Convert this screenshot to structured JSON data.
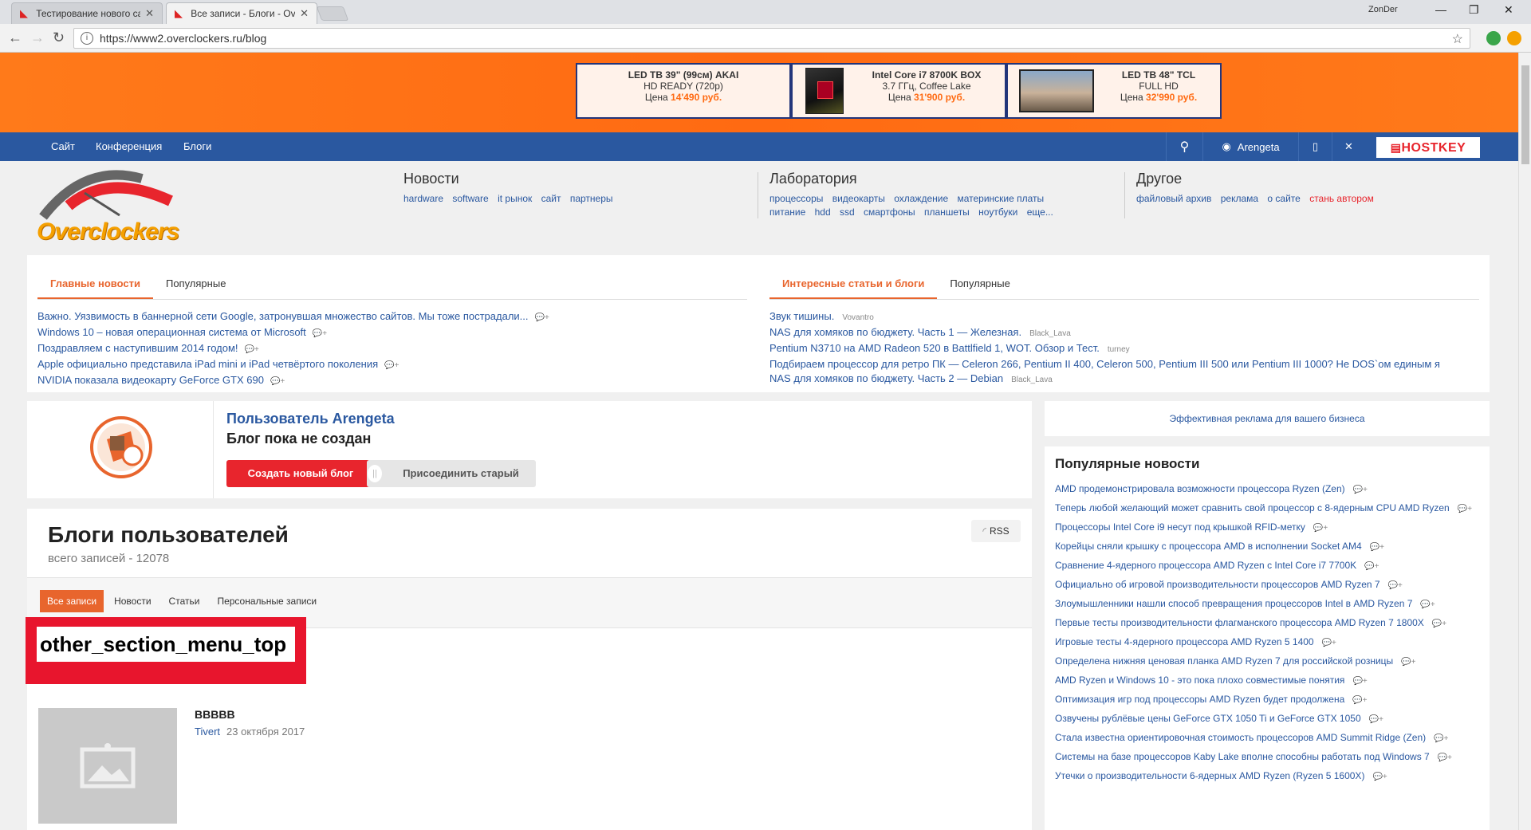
{
  "browser": {
    "tabs": [
      {
        "title": "Тестирование нового са",
        "active": false
      },
      {
        "title": "Все записи - Блоги - Ove",
        "active": true
      }
    ],
    "user_chip": "ZonDer",
    "url": "https://www2.overclockers.ru/blog"
  },
  "banner": {
    "ads": [
      {
        "name": "LED ТВ 39\" (99см) AKAI",
        "line2": "HD READY (720p)",
        "price_prefix": "Цена ",
        "price": "14'490 руб."
      },
      {
        "name": "Intel Core i7 8700K BOX",
        "line2": "3.7 ГГц, Coffee Lake",
        "price_prefix": "Цена ",
        "price": "31'900 руб."
      },
      {
        "name": "LED ТВ 48\" TCL",
        "line2": "FULL HD",
        "price_prefix": "Цена ",
        "price": "32'990 руб."
      }
    ]
  },
  "nav": {
    "links": [
      "Сайт",
      "Конференция",
      "Блоги"
    ],
    "user": "Arengeta",
    "sponsor": "HOSTKEY"
  },
  "logo_text": "Overclockers",
  "header": {
    "news": {
      "title": "Новости",
      "links": [
        "hardware",
        "software",
        "it рынок",
        "сайт",
        "партнеры"
      ]
    },
    "lab": {
      "title": "Лаборатория",
      "links1": [
        "процессоры",
        "видеокарты",
        "охлаждение",
        "материнские платы"
      ],
      "links2": [
        "питание",
        "hdd",
        "ssd",
        "смартфоны",
        "планшеты",
        "ноутбуки",
        "еще..."
      ]
    },
    "other": {
      "title": "Другое",
      "links": [
        "файловый архив",
        "реклама",
        "о сайте"
      ],
      "highlight": "стань автором"
    }
  },
  "news_panel": {
    "tabs": [
      "Главные новости",
      "Популярные"
    ],
    "items": [
      "Важно. Уязвимость в баннерной сети Google, затронувшая множество сайтов. Мы тоже пострадали...",
      "Windows 10 – новая операционная система от Microsoft",
      "Поздравляем с наступившим 2014 годом!",
      "Apple официально представила iPad mini и iPad четвёртого поколения",
      "NVIDIA показала видеокарту GeForce GTX 690"
    ]
  },
  "articles_panel": {
    "tabs": [
      "Интересные статьи и блоги",
      "Популярные"
    ],
    "items": [
      {
        "title": "Звук тишины.",
        "author": "Vovantro"
      },
      {
        "title": "NAS для хомяков по бюджету. Часть 1 — Железная.",
        "author": "Black_Lava"
      },
      {
        "title": "Pentium N3710 на AMD Radeon 520 в Battlfield 1, WOT. Обзор и Тест.",
        "author": "turney"
      },
      {
        "title": "Подбираем процессор для ретро ПК — Celeron 266, Pentium II 400, Celeron 500, Pentium III 500 или Pentium III 1000? Не DOS`ом единым я",
        "author": ""
      },
      {
        "title": "NAS для хомяков по бюджету. Часть 2 — Debian",
        "author": "Black_Lava"
      }
    ]
  },
  "user_panel": {
    "title": "Пользователь Arengeta",
    "subtitle": "Блог пока не создан",
    "create_button": "Создать новый блог",
    "join_button": "Присоединить старый"
  },
  "ad_link": "Эффективная реклама для вашего бизнеса",
  "blogs": {
    "title": "Блоги пользователей",
    "count": "всего записей - 12078",
    "rss": "RSS",
    "tabs": [
      "Все записи",
      "Новости",
      "Статьи",
      "Персональные записи"
    ],
    "placeholder_label": "other_section_menu_top",
    "post": {
      "title": "ВВВВВ",
      "author": "Tivert",
      "date": "23 октября 2017"
    }
  },
  "popular": {
    "title": "Популярные новости",
    "items": [
      "AMD продемонстрировала возможности процессора Ryzen (Zen)",
      "Теперь любой желающий может сравнить свой процессор с 8-ядерным CPU AMD Ryzen",
      "Процессоры Intel Core i9 несут под крышкой RFID-метку",
      "Корейцы сняли крышку с процессора AMD в исполнении Socket AM4",
      "Сравнение 4-ядерного процессора AMD Ryzen с Intel Core i7 7700K",
      "Официально об игровой производительности процессоров AMD Ryzen 7",
      "Злоумышленники нашли способ превращения процессоров Intel в AMD Ryzen 7",
      "Первые тесты производительности флагманского процессора AMD Ryzen 7 1800X",
      "Игровые тесты 4-ядерного процессора AMD Ryzen 5 1400",
      "Определена нижняя ценовая планка AMD Ryzen 7 для российской розницы",
      "AMD Ryzen и Windows 10 - это пока плохо совместимые понятия",
      "Оптимизация игр под процессоры AMD Ryzen будет продолжена",
      "Озвучены рублёвые цены GeForce GTX 1050 Ti и GeForce GTX 1050",
      "Стала известна ориентировочная стоимость процессоров AMD Summit Ridge (Zen)",
      "Системы на базе процессоров Kaby Lake вполне способны работать под Windows 7",
      "Утечки о производительности 6-ядерных AMD Ryzen (Ryzen 5 1600X)"
    ]
  },
  "comment_mark": "+",
  "colors": {
    "accent": "#e8652d",
    "nav": "#2a58a0",
    "red": "#e8252d",
    "banner": "#ff6a12"
  }
}
